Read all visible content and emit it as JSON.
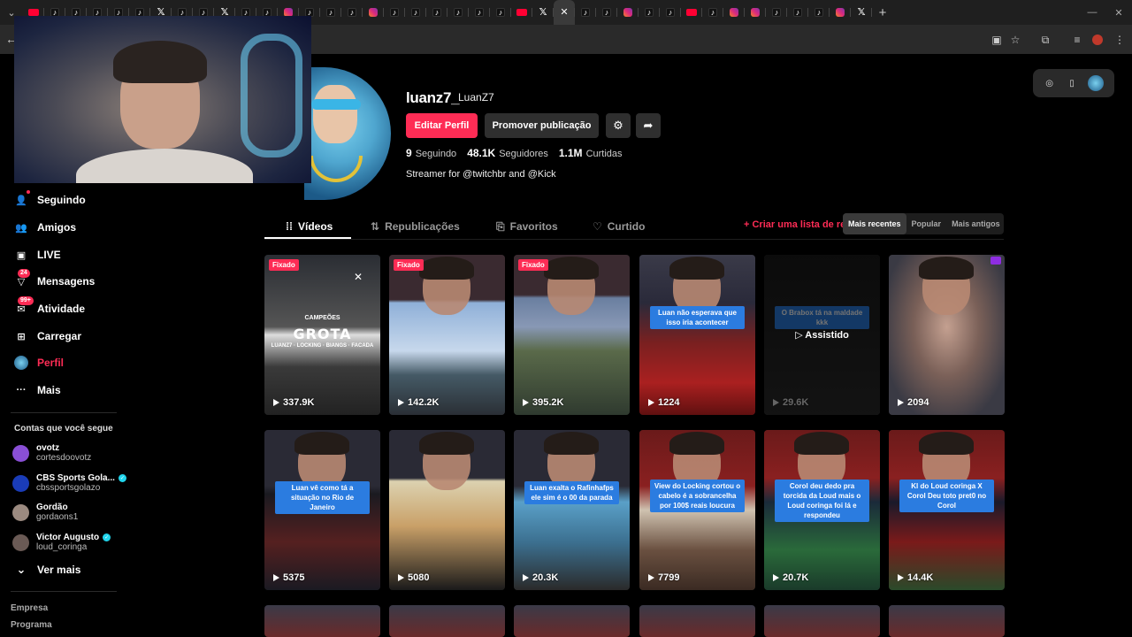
{
  "browser": {
    "tabs": [
      "yt",
      "tt",
      "tt",
      "tt",
      "tt",
      "tt",
      "x",
      "tt",
      "tt",
      "x",
      "tt",
      "tt",
      "ig",
      "tt",
      "tt",
      "tt",
      "ig",
      "tt",
      "tt",
      "tt",
      "tt",
      "tt",
      "tt",
      "yt",
      "x",
      "tt-active",
      "tt",
      "tt",
      "ig",
      "tt",
      "tt",
      "yt",
      "tt",
      "ig",
      "ig",
      "tt",
      "tt",
      "tt",
      "ig",
      "x"
    ],
    "new_tab_icon": "plus-icon"
  },
  "sidebar": {
    "nav": [
      {
        "label": "Seguindo",
        "icon": "following-icon",
        "badge": ""
      },
      {
        "label": "Amigos",
        "icon": "friends-icon",
        "badge": ""
      },
      {
        "label": "LIVE",
        "icon": "live-icon",
        "badge": ""
      },
      {
        "label": "Mensagens",
        "icon": "messages-icon",
        "badge": "24"
      },
      {
        "label": "Atividade",
        "icon": "activity-icon",
        "badge": "99+"
      },
      {
        "label": "Carregar",
        "icon": "upload-icon",
        "badge": ""
      },
      {
        "label": "Perfil",
        "icon": "profile-avatar",
        "badge": ""
      },
      {
        "label": "Mais",
        "icon": "more-icon",
        "badge": ""
      }
    ],
    "following_title": "Contas que você segue",
    "accounts": [
      {
        "name": "ovotz",
        "user": "cortesdoovotz",
        "verified": false,
        "color": "#8a4fd6"
      },
      {
        "name": "CBS Sports Gola...",
        "user": "cbssportsgolazo",
        "verified": true,
        "color": "#1a3cb8"
      },
      {
        "name": "Gordão",
        "user": "gordaons1",
        "verified": false,
        "color": "#9b8a80"
      },
      {
        "name": "Victor Augusto",
        "user": "loud_coringa",
        "verified": true,
        "color": "#6a5a55"
      }
    ],
    "see_more": "Ver mais",
    "footer": [
      "Empresa",
      "Programa"
    ]
  },
  "profile": {
    "username": "luanz7_",
    "nickname": "LuanZ7",
    "edit_button": "Editar Perfil",
    "promote_button": "Promover publicação",
    "stats": {
      "following_count": "9",
      "following_label": "Seguindo",
      "followers_count": "48.1K",
      "followers_label": "Seguidores",
      "likes_count": "1.1M",
      "likes_label": "Curtidas"
    },
    "bio": "Streamer for @twitchbr and @Kick"
  },
  "tabs": {
    "videos": "Vídeos",
    "reposts": "Republicações",
    "favorites": "Favoritos",
    "liked": "Curtido"
  },
  "create_list": "Criar uma lista de re",
  "sort": [
    "Mais recentes",
    "Popular",
    "Mais antigos"
  ],
  "pinned_label": "Fixado",
  "watched_label": "Assistido",
  "videos": [
    {
      "views": "337.9K",
      "pinned": true,
      "caption": "",
      "scene": "grota"
    },
    {
      "views": "142.2K",
      "pinned": true,
      "caption": "",
      "scene": "sky"
    },
    {
      "views": "395.2K",
      "pinned": true,
      "caption": "",
      "scene": "road"
    },
    {
      "views": "1224",
      "pinned": false,
      "caption": "Luan não esperava que isso iria acontecer",
      "scene": "red"
    },
    {
      "views": "29.6K",
      "pinned": false,
      "caption": "O Brabox tá na maldade kkk",
      "scene": "dark",
      "watched": true
    },
    {
      "views": "2094",
      "pinned": false,
      "caption": "",
      "scene": "closeup"
    },
    {
      "views": "5375",
      "pinned": false,
      "caption": "Luan vê como tá a situação no Rio de Janeiro",
      "scene": "city"
    },
    {
      "views": "5080",
      "pinned": false,
      "caption": "",
      "scene": "phone"
    },
    {
      "views": "20.3K",
      "pinned": false,
      "caption": "Luan exalta o Rafinhafps ele sim é o 00 da parada",
      "scene": "game"
    },
    {
      "views": "7799",
      "pinned": false,
      "caption": "View do Locking cortou o cabelo é a sobrancelha por 100$ reais loucura",
      "scene": "haircut"
    },
    {
      "views": "20.7K",
      "pinned": false,
      "caption": "Corol deu dedo pra torcida da Loud mais o Loud coringa foi lá e respondeu",
      "scene": "stadium"
    },
    {
      "views": "14.4K",
      "pinned": false,
      "caption": "Kl do Loud coringa X Corol Deu toto pret0 no Corol",
      "scene": "stadium2"
    }
  ]
}
